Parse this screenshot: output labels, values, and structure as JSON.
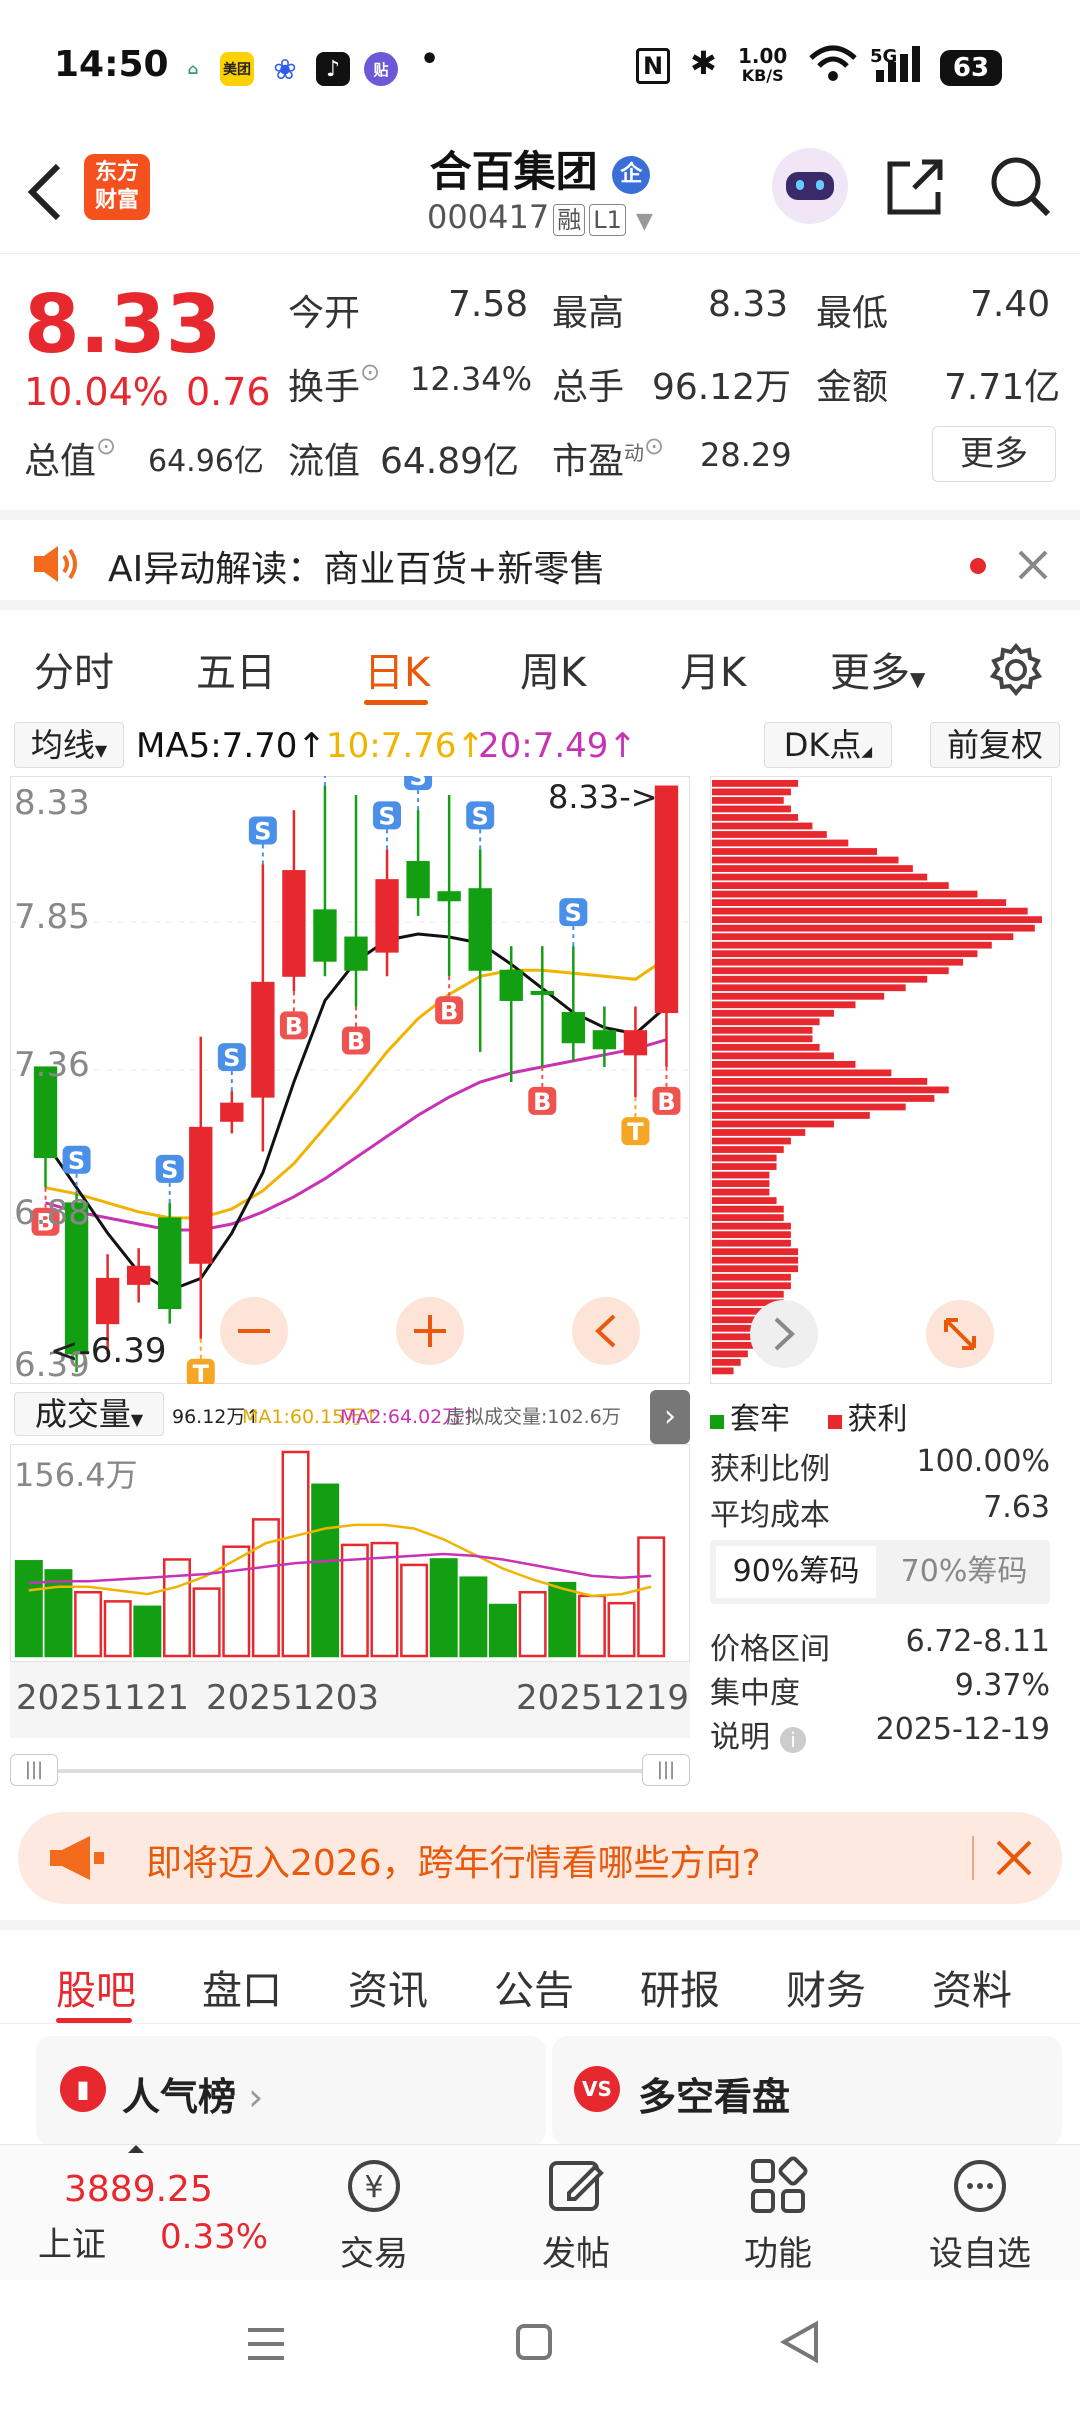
{
  "status_bar": {
    "time": "14:50",
    "app_icons": [
      "home-icon",
      "meituan-app-icon",
      "baidu-icon",
      "tiktok-icon",
      "tieba-icon"
    ],
    "meituan_label": "美团",
    "tieba_label": "贴",
    "dot": "•",
    "net_speed_value": "1.00",
    "net_speed_unit": "KB/S",
    "signal_label": "5G",
    "battery": "63"
  },
  "header": {
    "logo_line1": "东方",
    "logo_line2": "财富",
    "title": "合百集团",
    "title_badge": "企",
    "code": "000417",
    "tag_margin": "融",
    "tag_level": "L1"
  },
  "quote": {
    "price": "8.33",
    "change_pct": "10.04%",
    "change": "0.76",
    "open_label": "今开",
    "open": "7.58",
    "high_label": "最高",
    "high": "8.33",
    "low_label": "最低",
    "low": "7.40",
    "turnover_label": "换手",
    "turnover": "12.34%",
    "volume_label": "总手",
    "volume": "96.12万",
    "amount_label": "金额",
    "amount": "7.71亿",
    "mktcap_label": "总值",
    "mktcap": "64.96亿",
    "float_label": "流值",
    "float_cap": "64.89亿",
    "pe_label": "市盈",
    "pe_sup": "动",
    "pe": "28.29",
    "more": "更多"
  },
  "ai_bar": {
    "text": "AI异动解读：商业百货+新零售"
  },
  "chart_tabs": [
    "分时",
    "五日",
    "日K",
    "周K",
    "月K",
    "更多"
  ],
  "chart_tabs_active": 2,
  "ma_row": {
    "select": "均线",
    "ma5": "MA5:7.70",
    "ma10": "10:7.76",
    "ma20": "20:7.49",
    "dk": "DK点",
    "adjust": "前复权"
  },
  "kline": {
    "y_labels": [
      "8.33",
      "7.85",
      "7.36",
      "6.88",
      "6.39"
    ],
    "high_note": "8.33->",
    "low_note": "<-6.39",
    "colors": {
      "up": "#e8282f",
      "down": "#12a012",
      "ma5": "#111111",
      "ma10": "#f0b400",
      "ma20": "#c832b4"
    }
  },
  "chart_data": {
    "type": "candlestick",
    "date_labels": [
      "20251121",
      "20251203",
      "20251219"
    ],
    "ylim": [
      6.39,
      8.33
    ],
    "candles": [
      {
        "o": 7.4,
        "c": 7.1,
        "h": 7.4,
        "l": 7.0
      },
      {
        "o": 6.95,
        "c": 6.45,
        "h": 6.98,
        "l": 6.39
      },
      {
        "o": 6.55,
        "c": 6.7,
        "h": 6.78,
        "l": 6.45
      },
      {
        "o": 6.68,
        "c": 6.74,
        "h": 6.8,
        "l": 6.62
      },
      {
        "o": 6.9,
        "c": 6.6,
        "h": 6.95,
        "l": 6.55
      },
      {
        "o": 6.75,
        "c": 7.2,
        "h": 7.5,
        "l": 6.5
      },
      {
        "o": 7.22,
        "c": 7.28,
        "h": 7.32,
        "l": 7.18
      },
      {
        "o": 7.3,
        "c": 7.68,
        "h": 8.07,
        "l": 7.12
      },
      {
        "o": 7.7,
        "c": 8.05,
        "h": 8.25,
        "l": 7.65
      },
      {
        "o": 7.92,
        "c": 7.75,
        "h": 8.33,
        "l": 7.7
      },
      {
        "o": 7.83,
        "c": 7.72,
        "h": 8.3,
        "l": 7.6
      },
      {
        "o": 7.78,
        "c": 8.02,
        "h": 8.12,
        "l": 7.7
      },
      {
        "o": 8.08,
        "c": 7.96,
        "h": 8.25,
        "l": 7.9
      },
      {
        "o": 7.98,
        "c": 7.95,
        "h": 8.3,
        "l": 7.7
      },
      {
        "o": 7.99,
        "c": 7.72,
        "h": 8.12,
        "l": 7.45
      },
      {
        "o": 7.72,
        "c": 7.62,
        "h": 7.8,
        "l": 7.35
      },
      {
        "o": 7.65,
        "c": 7.64,
        "h": 7.8,
        "l": 7.4
      },
      {
        "o": 7.58,
        "c": 7.48,
        "h": 7.8,
        "l": 7.42
      },
      {
        "o": 7.52,
        "c": 7.46,
        "h": 7.6,
        "l": 7.4
      },
      {
        "o": 7.44,
        "c": 7.52,
        "h": 7.6,
        "l": 7.3
      },
      {
        "o": 7.58,
        "c": 8.33,
        "h": 8.33,
        "l": 7.4
      }
    ],
    "markers": [
      {
        "i": 0,
        "t": "B"
      },
      {
        "i": 1,
        "t": "S"
      },
      {
        "i": 4,
        "t": "S"
      },
      {
        "i": 5,
        "t": "T"
      },
      {
        "i": 6,
        "t": "S"
      },
      {
        "i": 7,
        "t": "S"
      },
      {
        "i": 8,
        "t": "B"
      },
      {
        "i": 9,
        "t": "S"
      },
      {
        "i": 10,
        "t": "B"
      },
      {
        "i": 11,
        "t": "S"
      },
      {
        "i": 12,
        "t": "S"
      },
      {
        "i": 13,
        "t": "B"
      },
      {
        "i": 14,
        "t": "S"
      },
      {
        "i": 16,
        "t": "B"
      },
      {
        "i": 17,
        "t": "S"
      },
      {
        "i": 19,
        "t": "T"
      },
      {
        "i": 20,
        "t": "B"
      }
    ],
    "ma5": [
      7.15,
      7.0,
      6.85,
      6.72,
      6.66,
      6.7,
      6.85,
      7.05,
      7.35,
      7.62,
      7.75,
      7.82,
      7.84,
      7.83,
      7.81,
      7.74,
      7.66,
      7.58,
      7.53,
      7.51,
      7.6
    ],
    "ma10": [
      7.0,
      6.98,
      6.95,
      6.92,
      6.9,
      6.9,
      6.93,
      6.99,
      7.08,
      7.2,
      7.32,
      7.45,
      7.56,
      7.64,
      7.7,
      7.72,
      7.72,
      7.71,
      7.7,
      7.69,
      7.76
    ],
    "ma20": [
      6.95,
      6.92,
      6.9,
      6.88,
      6.86,
      6.86,
      6.88,
      6.92,
      6.97,
      7.03,
      7.1,
      7.17,
      7.24,
      7.3,
      7.35,
      7.38,
      7.4,
      7.42,
      7.44,
      7.46,
      7.49
    ],
    "volume": [
      52,
      47,
      35,
      30,
      27,
      53,
      37,
      60,
      75,
      112,
      94,
      61,
      62,
      50,
      53,
      43,
      28,
      35,
      40,
      33,
      29,
      65
    ],
    "volume_up": [
      false,
      false,
      true,
      true,
      false,
      true,
      true,
      true,
      true,
      true,
      false,
      true,
      true,
      true,
      false,
      false,
      false,
      true,
      false,
      true,
      true,
      true
    ],
    "volume_ma1": [
      36,
      38,
      38,
      36,
      34,
      38,
      44,
      53,
      62,
      66,
      70,
      72,
      72,
      70,
      64,
      56,
      48,
      42,
      37,
      33,
      34,
      38
    ],
    "volume_ma2": [
      40,
      41,
      41,
      42,
      43,
      44,
      45,
      47,
      49,
      51,
      52,
      53,
      54,
      55,
      56,
      55,
      53,
      50,
      47,
      44,
      43,
      44
    ]
  },
  "volume_bar": {
    "select": "成交量",
    "vol": "96.12万↑",
    "ma1": "MA1:60.15万↑",
    "ma2": "MA2:64.02万↑",
    "sim": "虚拟成交量:102.6万",
    "y_label": "156.4万"
  },
  "chips": {
    "legend_trapped": "套牢",
    "legend_profit": "获利",
    "rows": [
      {
        "label": "获利比例",
        "value": "100.00%"
      },
      {
        "label": "平均成本",
        "value": "7.63"
      }
    ],
    "tab_90": "90%筹码",
    "tab_70": "70%筹码",
    "rows2": [
      {
        "label": "价格区间",
        "value": "6.72-8.11"
      },
      {
        "label": "集中度",
        "value": "9.37%"
      },
      {
        "label": "说明",
        "value": "2025-12-19"
      }
    ],
    "profile": [
      12,
      11,
      10,
      11,
      12,
      14,
      16,
      19,
      23,
      26,
      28,
      30,
      33,
      37,
      41,
      44,
      46,
      45,
      42,
      39,
      37,
      35,
      33,
      30,
      27,
      24,
      20,
      17,
      15,
      14,
      14,
      15,
      17,
      20,
      25,
      30,
      33,
      31,
      27,
      22,
      17,
      13,
      11,
      10,
      9,
      9,
      8,
      8,
      8,
      9,
      10,
      10,
      11,
      11,
      11,
      12,
      12,
      12,
      11,
      11,
      10,
      10,
      9,
      9,
      8,
      7,
      6,
      5,
      4,
      3
    ]
  },
  "banner": {
    "text": "即将迈入2026，跨年行情看哪些方向?"
  },
  "bottom_tabs": [
    "股吧",
    "盘口",
    "资讯",
    "公告",
    "研报",
    "财务",
    "资料"
  ],
  "bottom_tabs_active": 0,
  "cards": {
    "left": "人气榜",
    "right": "多空看盘"
  },
  "bottom_nav": {
    "index_value": "3889.25",
    "index_name": "上证",
    "index_change": "0.33%",
    "trade": "交易",
    "post": "发帖",
    "function": "功能",
    "watchlist": "设自选"
  }
}
